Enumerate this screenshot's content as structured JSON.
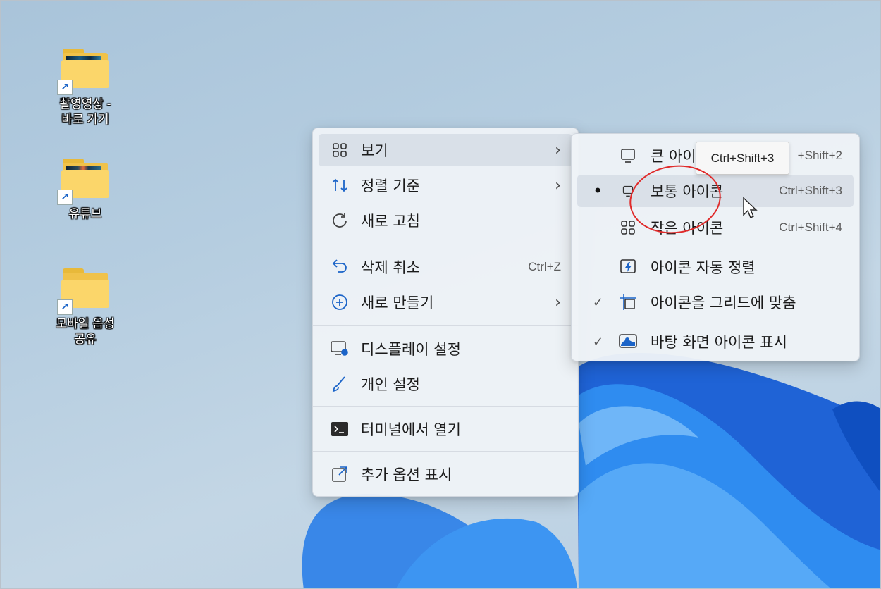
{
  "desktop_icons": [
    {
      "label": "촬영영상 -\n바로 가기",
      "shortcut": true
    },
    {
      "label": "유튜브",
      "shortcut": true
    },
    {
      "label": "모바일 음성\n공유",
      "shortcut": true
    }
  ],
  "main_menu": {
    "view": {
      "label": "보기",
      "arrow": "›"
    },
    "sort": {
      "label": "정렬 기준",
      "arrow": "›"
    },
    "refresh": {
      "label": "새로 고침"
    },
    "undo": {
      "label": "삭제 취소",
      "shortcut": "Ctrl+Z"
    },
    "new": {
      "label": "새로 만들기",
      "arrow": "›"
    },
    "display": {
      "label": "디스플레이 설정"
    },
    "personalize": {
      "label": "개인 설정"
    },
    "terminal": {
      "label": "터미널에서 열기"
    },
    "more": {
      "label": "추가 옵션 표시"
    }
  },
  "view_submenu": {
    "large": {
      "label": "큰 아이",
      "shortcut": "+Shift+2"
    },
    "medium": {
      "label": "보통 아이콘",
      "shortcut": "Ctrl+Shift+3",
      "selected_mark": "•"
    },
    "small": {
      "label": "작은 아이콘",
      "shortcut": "Ctrl+Shift+4"
    },
    "auto_arrange": {
      "label": "아이콘 자동 정렬"
    },
    "align_grid": {
      "label": "아이콘을 그리드에 맞춤",
      "check": "✓"
    },
    "show_icons": {
      "label": "바탕 화면 아이콘 표시",
      "check": "✓"
    }
  },
  "tooltip": "Ctrl+Shift+3",
  "colors": {
    "accent": "#1b64c8",
    "annotation": "#e02a2a"
  }
}
